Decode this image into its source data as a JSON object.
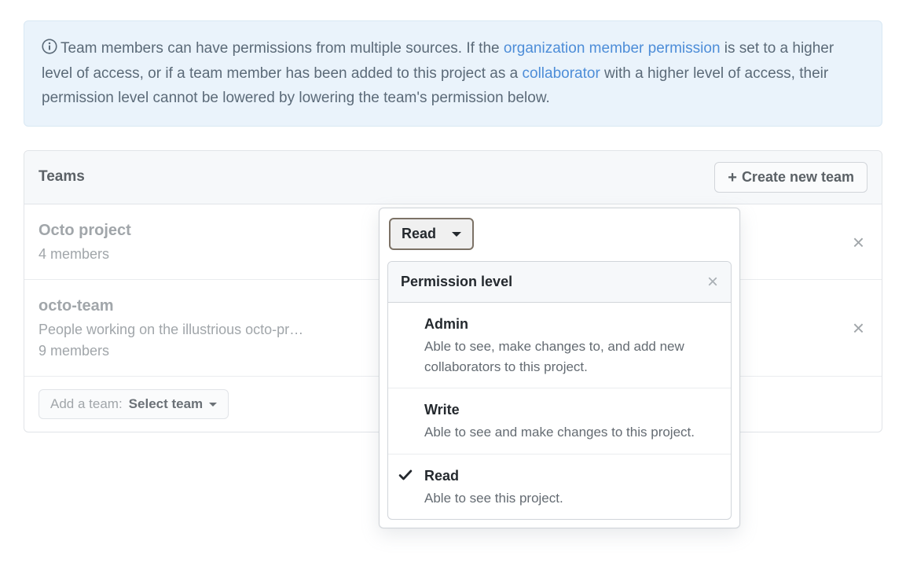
{
  "flash": {
    "text_1": "Team members can have permissions from multiple sources. If the ",
    "link_1": "organization member permission",
    "text_2": " is set to a higher level of access, or if a team member has been added to this project as a ",
    "link_2": "collaborator",
    "text_3": " with a higher level of access, their permission level cannot be lowered by lowering the team's permission below."
  },
  "section": {
    "title": "Teams",
    "create_button": "Create new team"
  },
  "teams": [
    {
      "name": "Octo project",
      "description": "",
      "members": "4 members",
      "permission": "Read"
    },
    {
      "name": "octo-team",
      "description": "People working on the illustrious octo-pr…",
      "members": "9 members",
      "permission": ""
    }
  ],
  "add_team": {
    "prefix": "Add a team: ",
    "label": "Select team"
  },
  "dropdown": {
    "header": "Permission level",
    "selected_button": "Read",
    "items": [
      {
        "title": "Admin",
        "desc": "Able to see, make changes to, and add new collaborators to this project.",
        "selected": false
      },
      {
        "title": "Write",
        "desc": "Able to see and make changes to this project.",
        "selected": false
      },
      {
        "title": "Read",
        "desc": "Able to see this project.",
        "selected": true
      }
    ]
  }
}
